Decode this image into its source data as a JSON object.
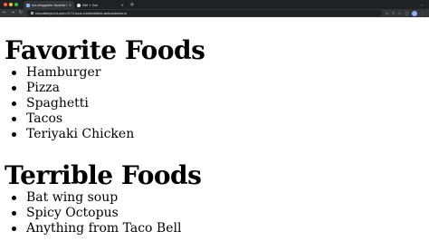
{
  "browser": {
    "tabs": [
      {
        "title": "rue-draggable: favorite foods",
        "active": true
      },
      {
        "title": "Vite + Vue",
        "active": false
      }
    ],
    "new_tab_symbol": "+",
    "address_bar": {
      "url": "sfepubtenjou1d-portr-5173.local-credentialless.webcontainer.io"
    }
  },
  "main": {
    "sections": [
      {
        "heading": "Favorite Foods",
        "items": [
          "Hamburger",
          "Pizza",
          "Spaghetti",
          "Tacos",
          "Teriyaki Chicken"
        ]
      },
      {
        "heading": "Terrible Foods",
        "items": [
          "Bat wing soup",
          "Spicy Octopus",
          "Anything from Taco Bell"
        ]
      }
    ]
  },
  "icons": {
    "back": "arrow-left-icon",
    "forward": "arrow-right-icon",
    "reload": "reload-icon",
    "bookmark": "star-icon",
    "menu": "more-vert-icon"
  },
  "colors": {
    "chrome_bg": "#202124",
    "toolbar_bg": "#35363a",
    "page_bg": "#ffffff",
    "text": "#000000"
  }
}
